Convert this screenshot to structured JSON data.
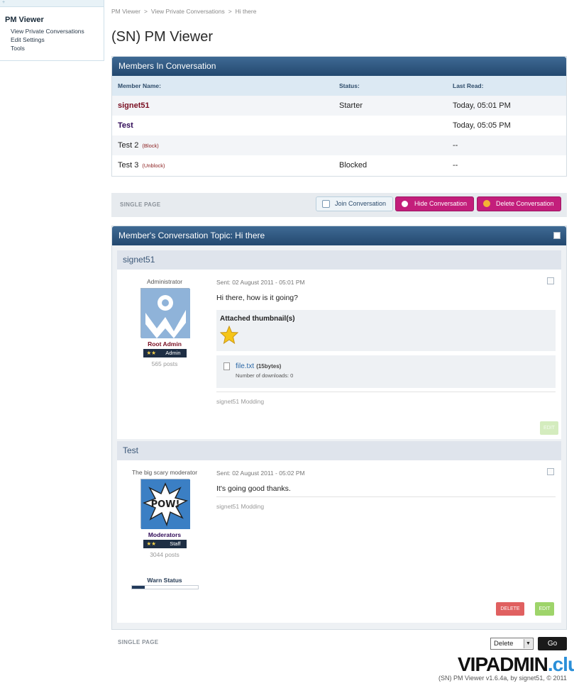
{
  "sidebar": {
    "toptext": "+",
    "title": "PM Viewer",
    "links": [
      "View Private Conversations",
      "Edit Settings",
      "Tools"
    ]
  },
  "breadcrumb": [
    "PM Viewer",
    "View Private Conversations",
    "Hi there"
  ],
  "breadcrumb_sep": ">",
  "page_title": "(SN) PM Viewer",
  "members": {
    "header": "Members In Conversation",
    "columns": [
      "Member Name:",
      "Status:",
      "Last Read:"
    ],
    "rows": [
      {
        "name": "signet51",
        "link": "",
        "status": "Starter",
        "last_read": "Today, 05:01 PM"
      },
      {
        "name": "Test",
        "link": "",
        "status": "",
        "last_read": "Today, 05:05 PM"
      },
      {
        "name": "Test 2",
        "link": "(Block)",
        "status": "",
        "last_read": "--"
      },
      {
        "name": "Test 3",
        "link": "(Unblock)",
        "status": "Blocked",
        "last_read": "--"
      }
    ]
  },
  "actions": {
    "pagination": "SINGLE PAGE",
    "join": "Join Conversation",
    "hide": "Hide Conversation",
    "delete": "Delete Conversation"
  },
  "topic": {
    "header": "Member's Conversation Topic: Hi there",
    "posts": [
      {
        "author": "signet51",
        "user_title": "Administrator",
        "group": "Root Admin",
        "group_color": "#7a0f22",
        "rank": "Admin",
        "rank_stars": "★★",
        "posts": "565 posts",
        "sent": "Sent: 02 August 2011 - 05:01 PM",
        "message": "Hi there, how is it going?",
        "attach_title": "Attached thumbnail(s)",
        "file_name": "file.txt",
        "file_size": "(15bytes)",
        "downloads": "Number of downloads: 0",
        "signature": "signet51 Modding",
        "edit": "EDIT"
      },
      {
        "author": "Test",
        "user_title": "The big scary moderator",
        "group": "Moderators",
        "group_color": "#2f0a57",
        "rank": "Staff",
        "rank_stars": "★★",
        "posts": "3044 posts",
        "sent": "Sent: 02 August 2011 - 05:02 PM",
        "message": "It's going good thanks.",
        "signature": "signet51 Modding",
        "warn_label": "Warn Status",
        "warn_level": 0.2,
        "delete": "DELETE",
        "edit": "EDIT"
      }
    ]
  },
  "bottom": {
    "pagination": "SINGLE PAGE",
    "select_value": "Delete",
    "go": "Go"
  },
  "watermark": {
    "main": "VIPADMIN",
    "accent": ".club"
  },
  "footer": "(SN) PM Viewer v1.6.4a, by signet51, © 2011",
  "colors": {
    "header_blue": "#2d5580",
    "accent_pink": "#c31e7b",
    "delete_red": "#e06060",
    "edit_green": "#9ed46a"
  }
}
